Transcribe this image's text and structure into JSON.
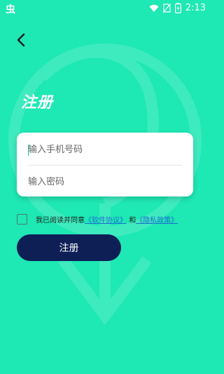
{
  "status_bar": {
    "app_icon_glyph": "虫",
    "time": "2:13",
    "icons": [
      "wifi-icon",
      "no-sim-icon",
      "battery-charging-icon"
    ]
  },
  "page": {
    "title": "注册",
    "back_icon": "chevron-left-icon"
  },
  "form": {
    "phone_placeholder": "输入手机号码",
    "password_placeholder": "输入密码"
  },
  "agreement": {
    "prefix": "我已阅读并同意",
    "software_link": "《软件协议》",
    "and": "和",
    "privacy_link": "《隐私政策》"
  },
  "buttons": {
    "register": "注册"
  },
  "colors": {
    "background": "#1EE8B4",
    "button": "#0E1F56",
    "link": "#1b6fd0"
  }
}
